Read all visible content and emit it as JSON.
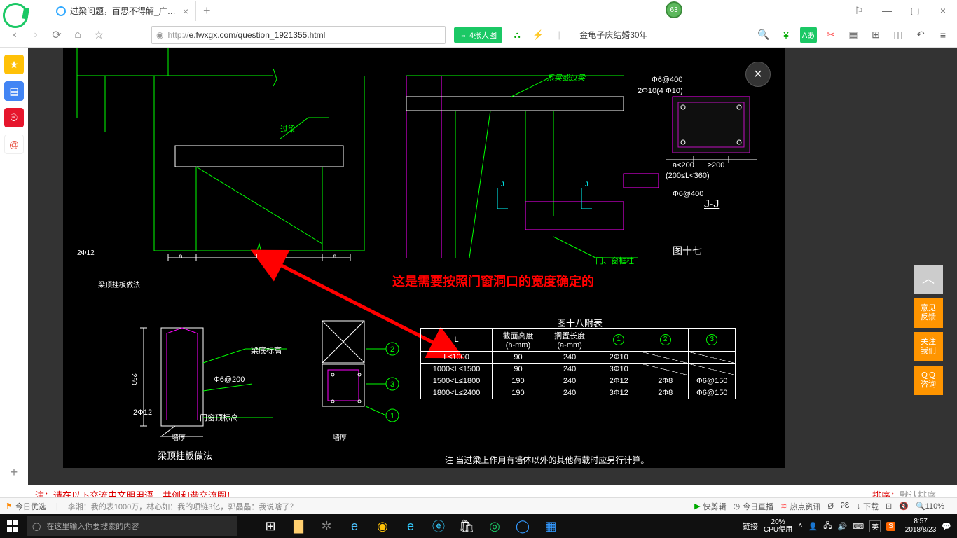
{
  "titlebar": {
    "tab_title": "过梁问题，百思不得解_广联达服",
    "badge": "63"
  },
  "addrbar": {
    "url_prefix": "http://",
    "url_main": "e.fwxgx.com/question_1921355.html",
    "big_image_btn": "⇔ 4张大图",
    "news": "金龟子庆结婚30年"
  },
  "sidebar_float": {
    "top": "⌃",
    "feedback": "意见\n反馈",
    "follow": "关注\n我们",
    "qq": "ＱＱ\n咨询"
  },
  "red_annotation": "这是需要按照门窗洞口的宽度确定的",
  "bottom_red_left": "注：请在以下交流中文明用语，共创和谐交流圈！",
  "bottom_red_right_label": "排序：",
  "bottom_red_right_value": "默认排序",
  "newsbar": {
    "today": "今日优选",
    "headline": "李湘：我的表1000万，林心如：我的项链3亿，郭晶晶：我说啥了？",
    "cut": "快剪辑",
    "live": "今日直播",
    "hot": "热点资讯",
    "dl": "下载",
    "zoom": "110%"
  },
  "taskbar": {
    "search_placeholder": "在这里输入你要搜索的内容",
    "link": "链接",
    "cpu_pct": "20%",
    "cpu_label": "CPU使用",
    "time": "8:57",
    "date": "2018/8/23",
    "lang": "英"
  },
  "cad": {
    "label_guoliang": "过梁",
    "label_xiliang": "系梁或过梁",
    "label_menkuang": "门、窗框柱",
    "label_rebar1": "Φ6@400",
    "label_rebar2": "2Φ10(4 Φ10)",
    "label_jj": "J-J",
    "label_dim1": "a<200",
    "label_dim2": "≥200",
    "label_dim3": "(200≤L<360)",
    "label_rebar3": "Φ6@400",
    "label_fig17": "图十七",
    "label_2f12": "2Φ12",
    "label_hang": "梁顶挂板做法",
    "label_beam_bottom": "梁底标高",
    "label_6at200": "Φ6@200",
    "label_door_top": "门窗顶标高",
    "label_250": "250",
    "label_wallthk": "墙厚",
    "table_title": "图十八附表",
    "table_note": "注  当过梁上作用有墙体以外的其他荷载时应另行计算。",
    "th_L": "L",
    "th_h": "截面高度\n(h-mm)",
    "th_a": "搁置长度\n(a-mm)",
    "th_1": "1",
    "th_2": "2",
    "th_3": "3",
    "rows": [
      {
        "L": "L≤1000",
        "h": "90",
        "a": "240",
        "c1": "2Φ10",
        "c2": "",
        "c3": ""
      },
      {
        "L": "1000<L≤1500",
        "h": "90",
        "a": "240",
        "c1": "3Φ10",
        "c2": "",
        "c3": ""
      },
      {
        "L": "1500<L≤1800",
        "h": "190",
        "a": "240",
        "c1": "2Φ12",
        "c2": "2Φ8",
        "c3": "Φ6@150"
      },
      {
        "L": "1800<L≤2400",
        "h": "190",
        "a": "240",
        "c1": "3Φ12",
        "c2": "2Φ8",
        "c3": "Φ6@150"
      }
    ]
  }
}
